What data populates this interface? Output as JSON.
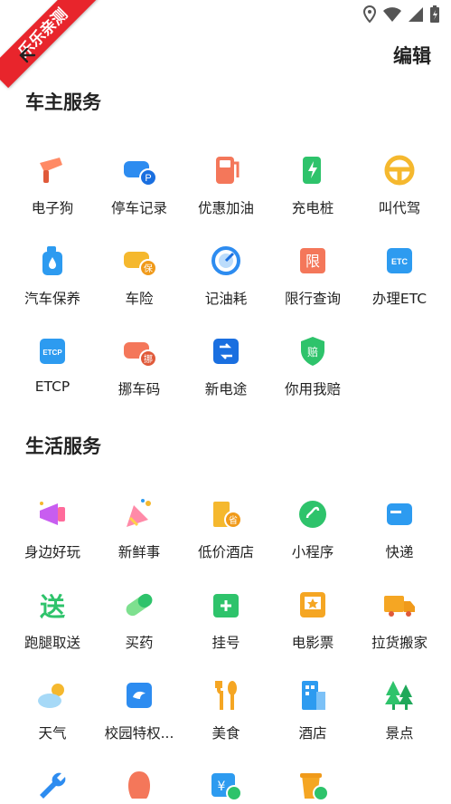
{
  "watermark": "乐乐亲测",
  "header": {
    "edit_label": "编辑"
  },
  "sections": [
    {
      "title": "车主服务",
      "items": [
        {
          "label": "电子狗",
          "icon": "speed-camera-icon"
        },
        {
          "label": "停车记录",
          "icon": "parking-record-icon"
        },
        {
          "label": "优惠加油",
          "icon": "fuel-pump-icon"
        },
        {
          "label": "充电桩",
          "icon": "charging-pile-icon"
        },
        {
          "label": "叫代驾",
          "icon": "steering-wheel-icon"
        },
        {
          "label": "汽车保养",
          "icon": "oil-bottle-icon"
        },
        {
          "label": "车险",
          "icon": "car-insurance-icon"
        },
        {
          "label": "记油耗",
          "icon": "gauge-icon"
        },
        {
          "label": "限行查询",
          "icon": "restriction-icon"
        },
        {
          "label": "办理ETC",
          "icon": "etc-card-icon"
        },
        {
          "label": "ETCP",
          "icon": "etcp-icon"
        },
        {
          "label": "挪车码",
          "icon": "move-car-icon"
        },
        {
          "label": "新电途",
          "icon": "new-charging-icon"
        },
        {
          "label": "你用我赔",
          "icon": "compensation-shield-icon"
        }
      ]
    },
    {
      "title": "生活服务",
      "items": [
        {
          "label": "身边好玩",
          "icon": "megaphone-icon"
        },
        {
          "label": "新鲜事",
          "icon": "party-popper-icon"
        },
        {
          "label": "低价酒店",
          "icon": "hotel-discount-icon"
        },
        {
          "label": "小程序",
          "icon": "mini-program-icon"
        },
        {
          "label": "快递",
          "icon": "express-card-icon"
        },
        {
          "label": "跑腿取送",
          "icon": "errand-icon"
        },
        {
          "label": "买药",
          "icon": "pill-icon"
        },
        {
          "label": "挂号",
          "icon": "calendar-plus-icon"
        },
        {
          "label": "电影票",
          "icon": "movie-ticket-icon"
        },
        {
          "label": "拉货搬家",
          "icon": "truck-icon"
        },
        {
          "label": "天气",
          "icon": "weather-icon"
        },
        {
          "label": "校园特权...",
          "icon": "campus-icon"
        },
        {
          "label": "美食",
          "icon": "cutlery-icon"
        },
        {
          "label": "酒店",
          "icon": "building-icon"
        },
        {
          "label": "景点",
          "icon": "trees-icon"
        },
        {
          "label": "",
          "icon": "wrench-icon"
        },
        {
          "label": "",
          "icon": "hair-icon"
        },
        {
          "label": "",
          "icon": "money-link-icon"
        },
        {
          "label": "",
          "icon": "drink-link-icon"
        }
      ]
    }
  ]
}
